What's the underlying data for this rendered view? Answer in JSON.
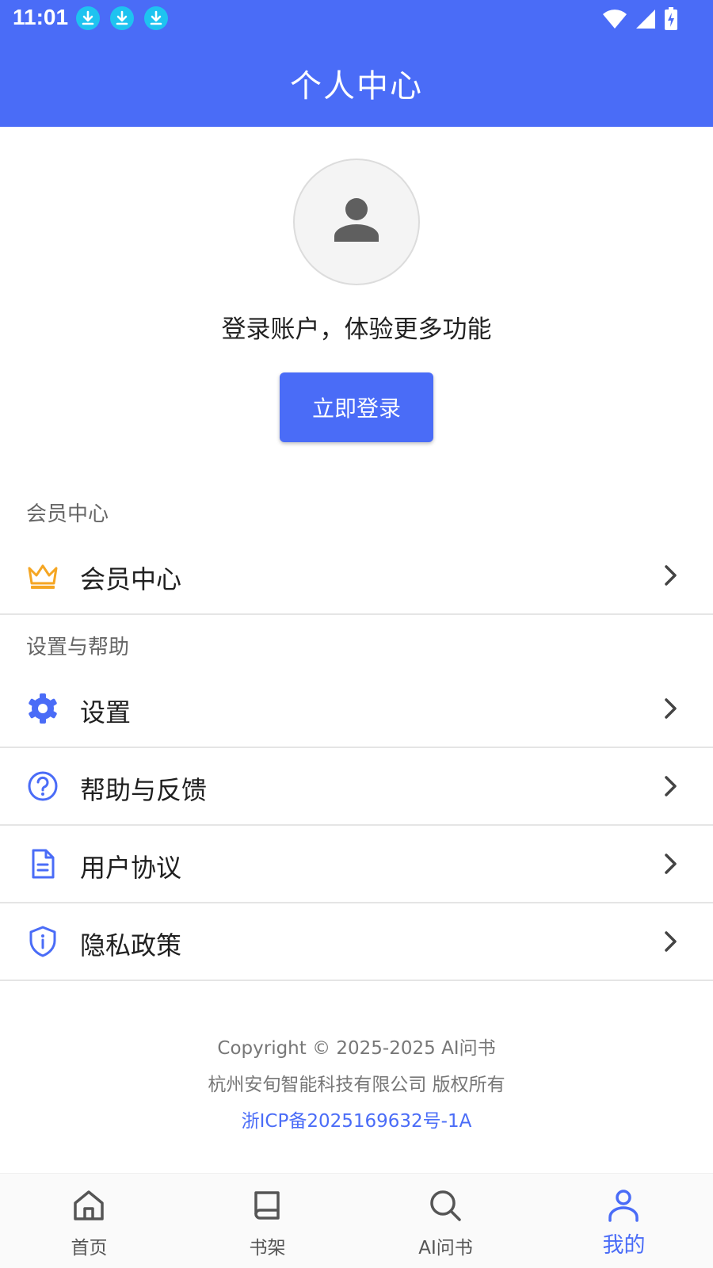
{
  "status_bar": {
    "time": "11:01"
  },
  "header": {
    "title": "个人中心"
  },
  "profile": {
    "prompt": "登录账户，体验更多功能",
    "login_button": "立即登录"
  },
  "sections": {
    "membership": {
      "title": "会员中心",
      "items": [
        {
          "label": "会员中心",
          "icon": "crown-icon"
        }
      ]
    },
    "settings": {
      "title": "设置与帮助",
      "items": [
        {
          "label": "设置",
          "icon": "gear-icon"
        },
        {
          "label": "帮助与反馈",
          "icon": "help-circle-icon"
        },
        {
          "label": "用户协议",
          "icon": "document-icon"
        },
        {
          "label": "隐私政策",
          "icon": "shield-info-icon"
        }
      ]
    }
  },
  "footer": {
    "copyright": "Copyright © 2025-2025 AI问书",
    "company": "杭州安旬智能科技有限公司 版权所有",
    "icp": "浙ICP备2025169632号-1A"
  },
  "bottom_nav": {
    "tabs": [
      {
        "label": "首页",
        "icon": "home-icon"
      },
      {
        "label": "书架",
        "icon": "book-icon"
      },
      {
        "label": "AI问书",
        "icon": "search-icon"
      },
      {
        "label": "我的",
        "icon": "user-icon",
        "active": true
      }
    ]
  },
  "colors": {
    "primary": "#4a6cf7",
    "crown": "#f5a623",
    "download_badge": "#1ec3f0"
  }
}
